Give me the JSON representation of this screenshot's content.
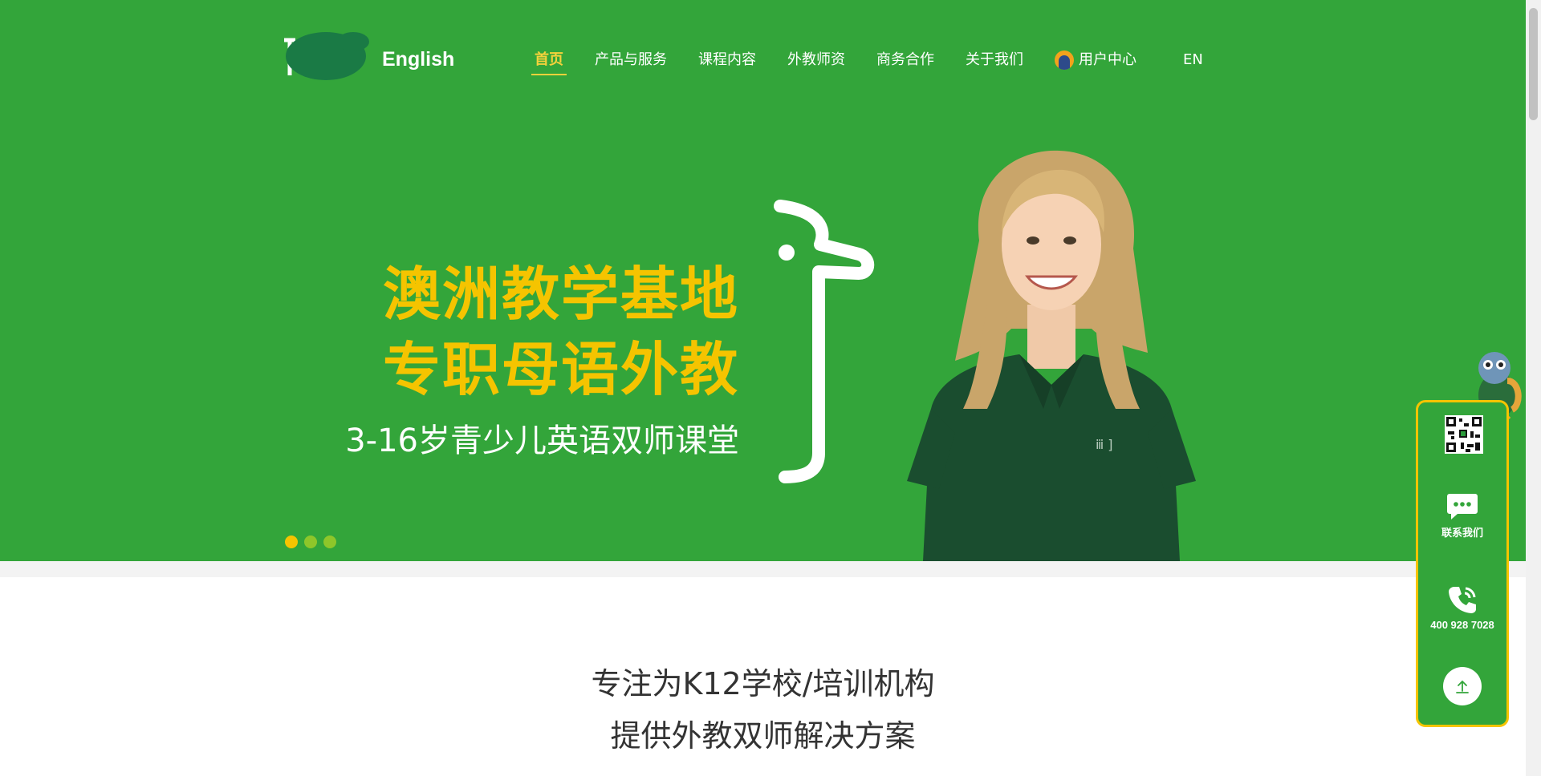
{
  "header": {
    "logo_text": "English",
    "nav": [
      {
        "label": "首页",
        "active": true
      },
      {
        "label": "产品与服务"
      },
      {
        "label": "课程内容"
      },
      {
        "label": "外教师资"
      },
      {
        "label": "商务合作"
      },
      {
        "label": "关于我们"
      },
      {
        "label": "用户中心",
        "icon": "user-avatar-icon"
      }
    ],
    "lang": "EN"
  },
  "banner": {
    "headline_1": "澳洲教学基地",
    "headline_2": "专职母语外教",
    "subline": "3-16岁青少儿英语双师课堂",
    "slides": 3,
    "active_slide": 1
  },
  "intro": {
    "line_1": "专注为K12学校/培训机构",
    "line_2": "提供外教双师解决方案"
  },
  "side_panel": {
    "contact_label": "联系我们",
    "phone": "400 928 7028"
  },
  "colors": {
    "brand_green": "#33a53a",
    "accent_yellow": "#f5c400",
    "dot_inactive": "#8ec62a"
  }
}
